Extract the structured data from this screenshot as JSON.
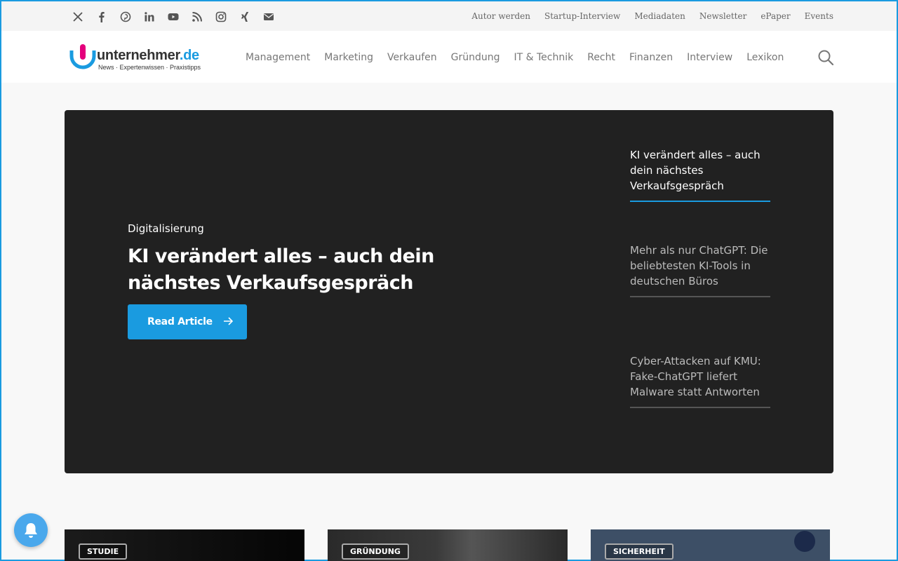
{
  "topbar": {
    "social_icons": [
      "x-icon",
      "facebook-icon",
      "pinterest-icon",
      "linkedin-icon",
      "youtube-icon",
      "rss-icon",
      "instagram-icon",
      "xing-icon",
      "email-icon"
    ],
    "links": [
      "Autor werden",
      "Startup-Interview",
      "Mediadaten",
      "Newsletter",
      "ePaper",
      "Events"
    ]
  },
  "header": {
    "logo_main": "unternehmer",
    "logo_tld": ".de",
    "logo_sub": "News · Expertenwissen · Praxistipps",
    "nav": [
      "Management",
      "Marketing",
      "Verkaufen",
      "Gründung",
      "IT & Technik",
      "Recht",
      "Finanzen",
      "Interview",
      "Lexikon"
    ]
  },
  "hero": {
    "category": "Digitalisierung",
    "title": "KI verändert alles – auch dein nächstes Verkaufsgespräch",
    "button": "Read Article",
    "side_items": [
      "KI verändert alles – auch dein nächstes Verkaufsgespräch",
      "Mehr als nur ChatGPT: Die beliebtesten KI-Tools in deutschen Büros",
      "Cyber-Attacken auf KMU: Fake-ChatGPT liefert Malware statt Antworten"
    ]
  },
  "cards": [
    {
      "tag": "STUDIE"
    },
    {
      "tag": "GRÜNDUNG"
    },
    {
      "tag": "SICHERHEIT"
    }
  ],
  "colors": {
    "accent": "#1a9be0",
    "logo_pink": "#e4007c",
    "hero_bg": "#212121"
  }
}
